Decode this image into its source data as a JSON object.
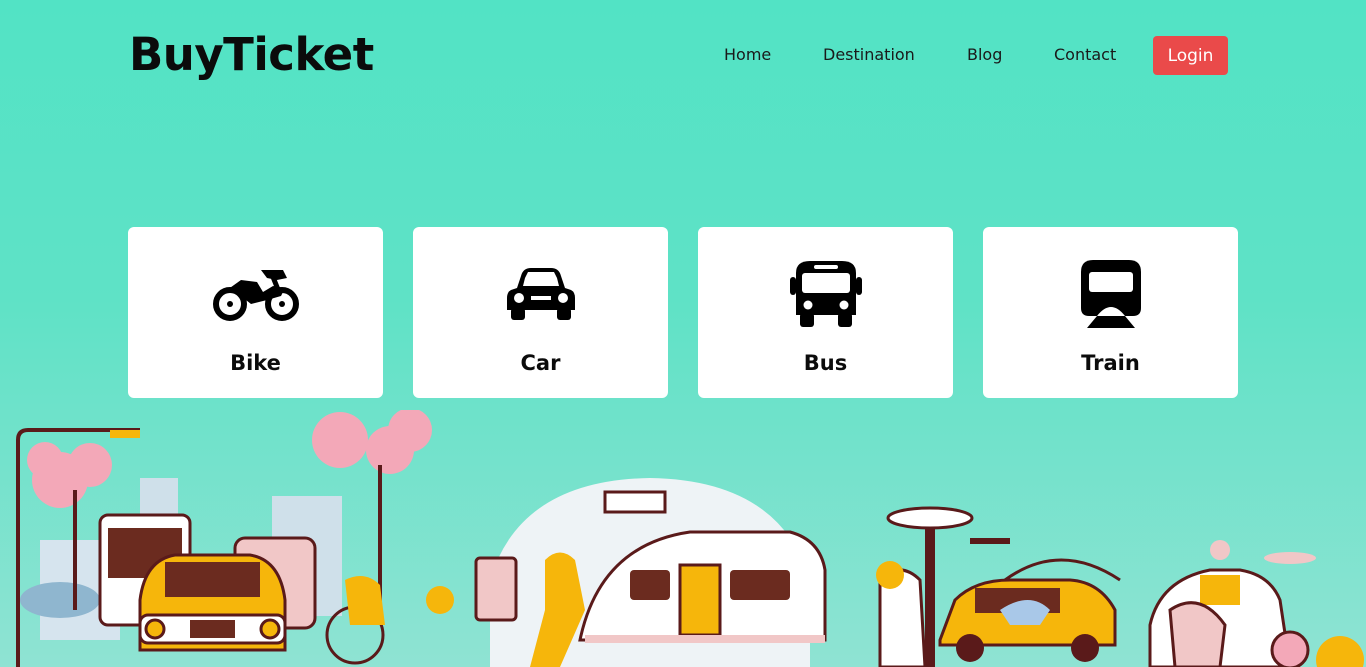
{
  "header": {
    "brand": "BuyTicket",
    "nav": [
      {
        "label": "Home"
      },
      {
        "label": "Destination"
      },
      {
        "label": "Blog"
      },
      {
        "label": "Contact"
      }
    ],
    "login_label": "Login"
  },
  "categories": [
    {
      "label": "Bike",
      "icon": "motorcycle-icon"
    },
    {
      "label": "Car",
      "icon": "car-icon"
    },
    {
      "label": "Bus",
      "icon": "bus-icon"
    },
    {
      "label": "Train",
      "icon": "train-icon"
    }
  ],
  "colors": {
    "background": "#52e3c5",
    "login": "#ea4a4a",
    "card": "#ffffff",
    "text": "#0b0b0b"
  }
}
